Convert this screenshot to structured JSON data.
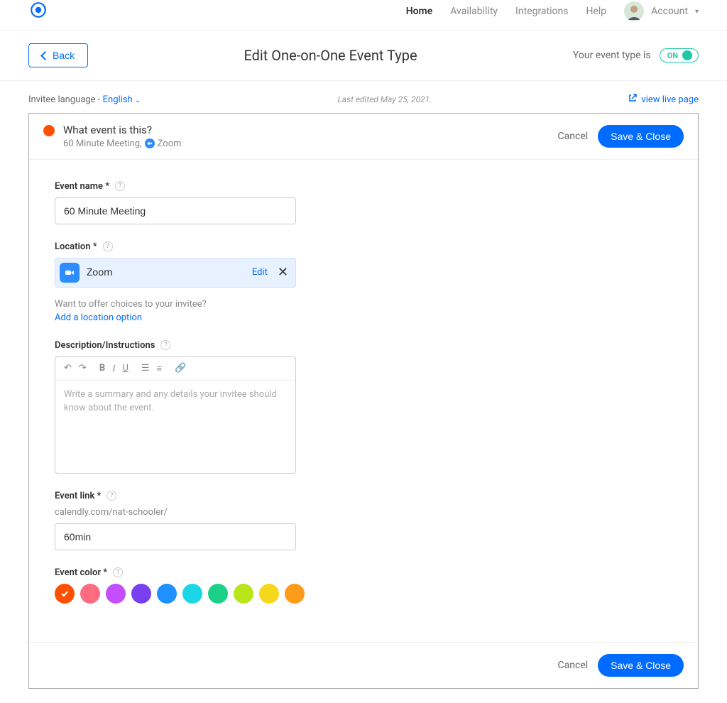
{
  "nav": {
    "home": "Home",
    "availability": "Availability",
    "integrations": "Integrations",
    "help": "Help",
    "account": "Account"
  },
  "subnav": {
    "back": "Back",
    "title": "Edit One-on-One Event Type",
    "toggle_label": "Your event type is",
    "toggle_state": "ON"
  },
  "meta": {
    "invitee_lang_label": "Invitee language - ",
    "invitee_lang_value": "English",
    "last_edited": "Last edited May 25, 2021.",
    "view_live": "view live page"
  },
  "header": {
    "title": "What event is this?",
    "sub_text": "60 Minute Meeting,",
    "sub_app": "Zoom",
    "cancel": "Cancel",
    "save": "Save & Close"
  },
  "form": {
    "event_name_label": "Event name *",
    "event_name_value": "60 Minute Meeting",
    "location_label": "Location *",
    "location_value": "Zoom",
    "location_edit": "Edit",
    "location_hint": "Want to offer choices to your invitee?",
    "location_add": "Add a location option",
    "description_label": "Description/Instructions",
    "description_placeholder": "Write a summary and any details your invitee should know about the event.",
    "event_link_label": "Event link *",
    "event_link_prefix": "calendly.com/nat-schooler/",
    "event_link_value": "60min",
    "event_color_label": "Event color *"
  },
  "colors": [
    "#ff4f00",
    "#ff6b81",
    "#c44dff",
    "#7b3ff2",
    "#1e90ff",
    "#1bd6e6",
    "#1ad187",
    "#b8e61b",
    "#f5d81b",
    "#ff9b1b"
  ],
  "selected_color_index": 0,
  "footer": {
    "cancel": "Cancel",
    "save": "Save & Close"
  }
}
